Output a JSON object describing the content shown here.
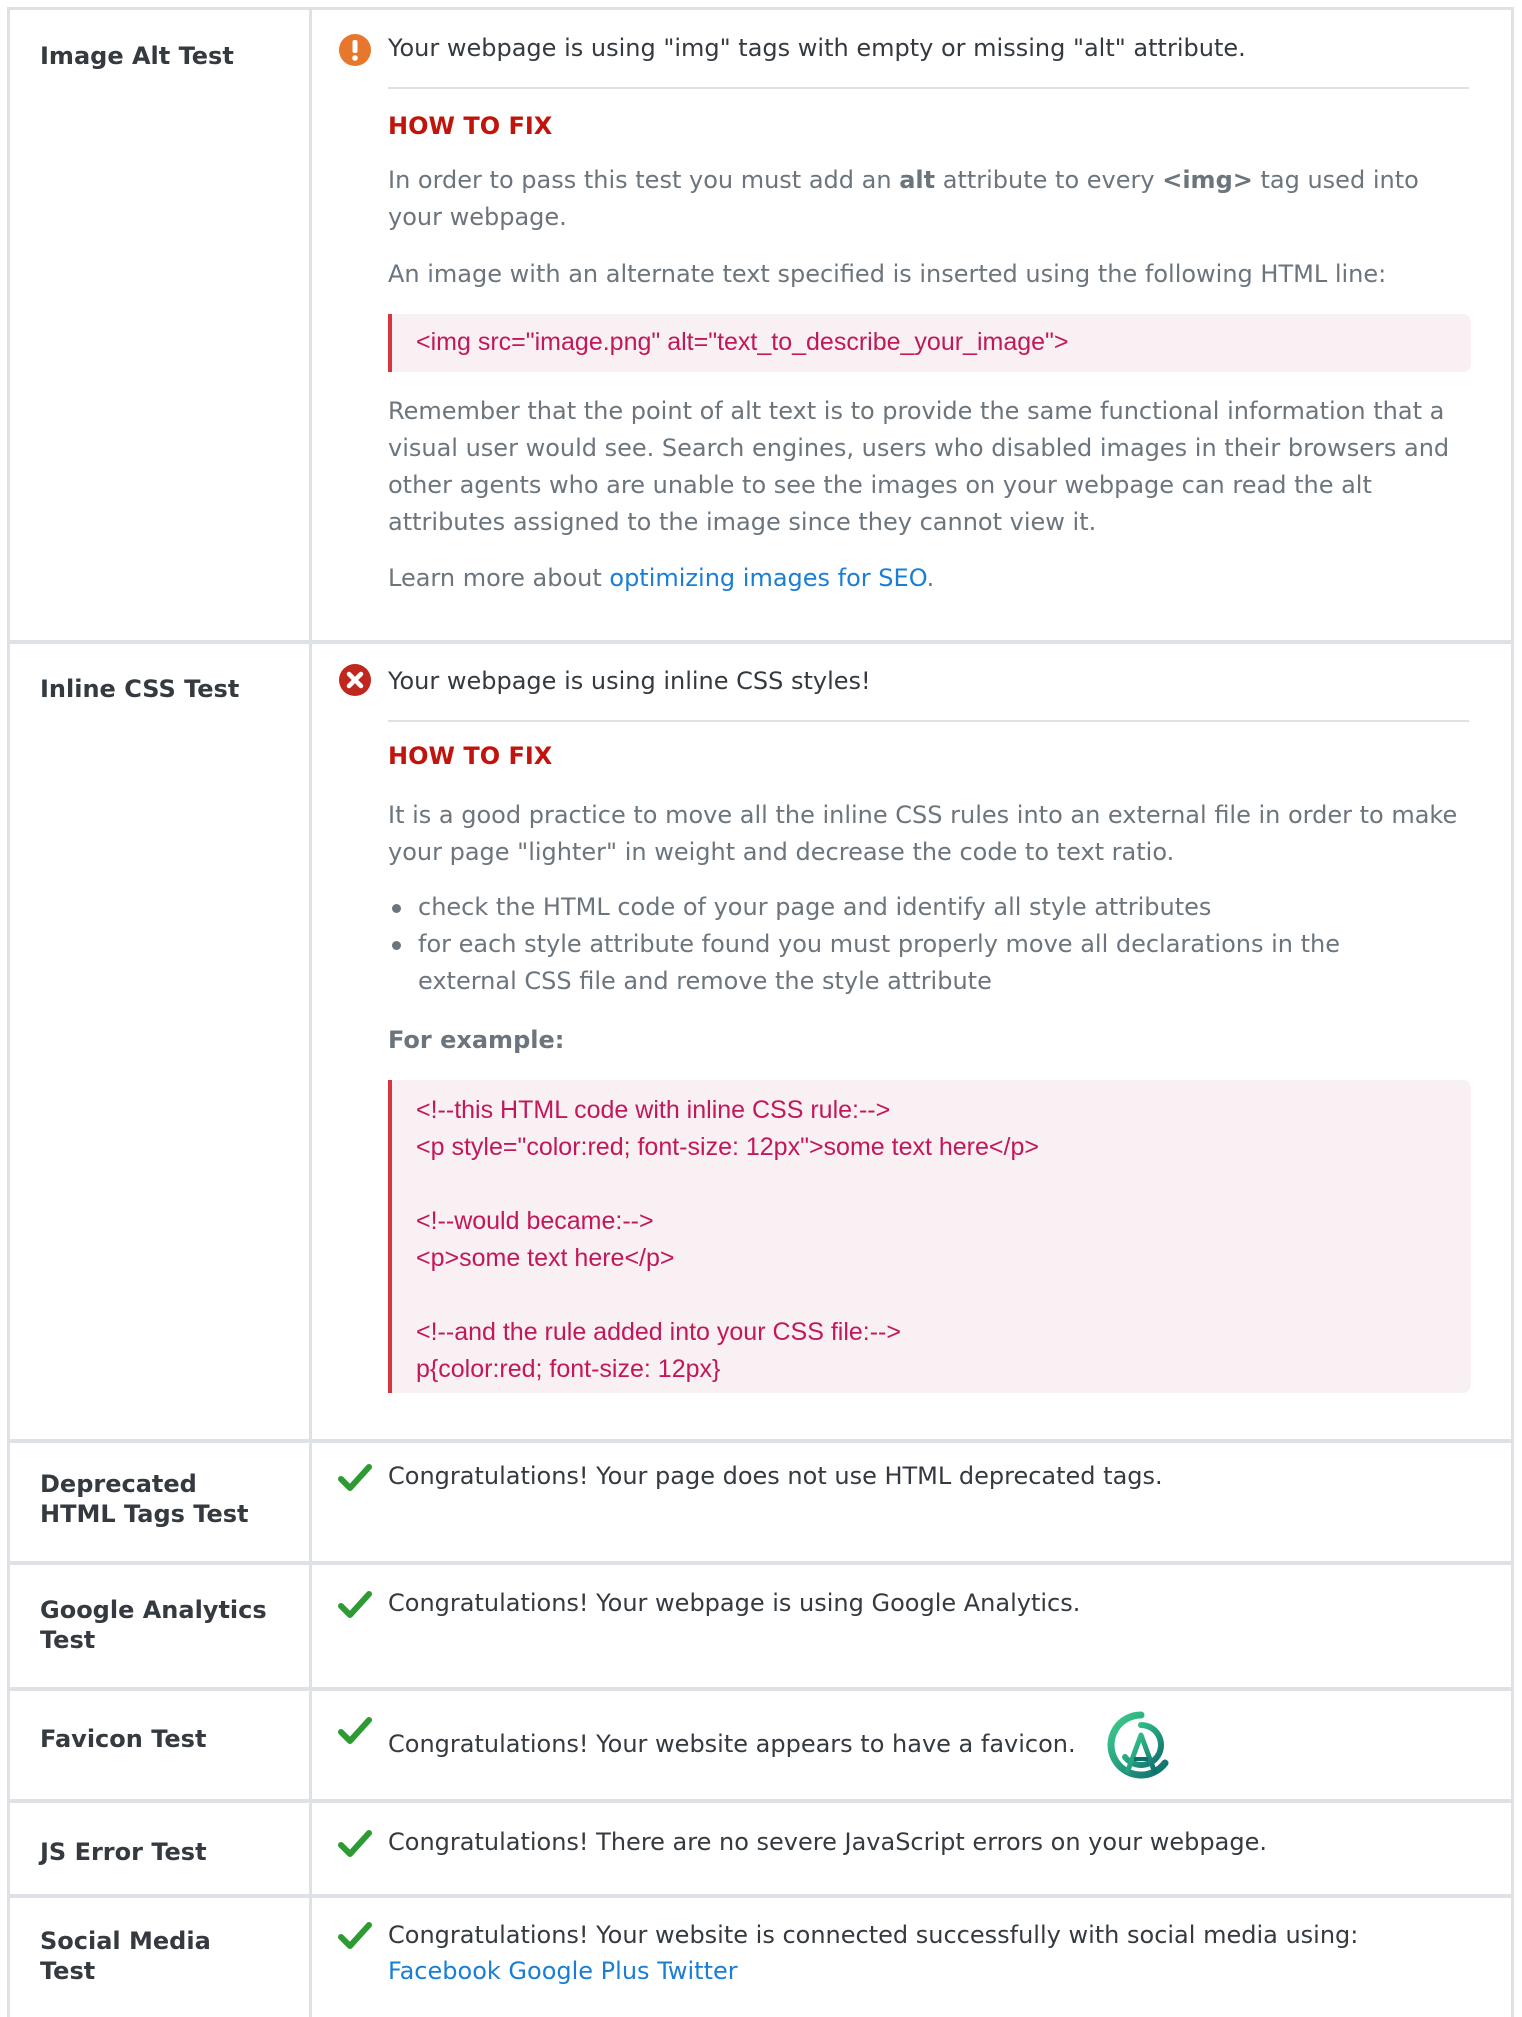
{
  "rows": {
    "image_alt": {
      "label": "Image Alt Test",
      "message": "Your webpage is using \"img\" tags with empty or missing \"alt\" attribute.",
      "how_to_fix": "HOW TO FIX",
      "p1_a": "In order to pass this test you must add an ",
      "p1_b": "alt",
      "p1_c": " attribute to every ",
      "p1_d": "<img>",
      "p1_e": " tag used into your webpage.",
      "p2": "An image with an alternate text specified is inserted using the following HTML line:",
      "code": "<img src=\"image.png\" alt=\"text_to_describe_your_image\">",
      "p3": "Remember that the point of alt text is to provide the same functional information that a visual user would see. Search engines, users who disabled images in their browsers and other agents who are unable to see the images on your webpage can read the alt attributes assigned to the image since they cannot view it.",
      "p4_a": "Learn more about ",
      "p4_link": "optimizing images for SEO",
      "p4_b": "."
    },
    "inline_css": {
      "label": "Inline CSS Test",
      "message": "Your webpage is using inline CSS styles!",
      "how_to_fix": "HOW TO FIX",
      "p1": "It is a good practice to move all the inline CSS rules into an external file in order to make your page \"lighter\" in weight and decrease the code to text ratio.",
      "bullet1": "check the HTML code of your page and identify all style attributes",
      "bullet2": "for each style attribute found you must properly move all declarations in the external CSS file and remove the style attribute",
      "example_label": "For example:",
      "code_lines": [
        "<!--this HTML code with inline CSS rule:-->",
        "<p style=\"color:red; font-size: 12px\">some text here</p>",
        "",
        "<!--would became:-->",
        "<p>some text here</p>",
        "",
        "<!--and the rule added into your CSS file:-->",
        "p{color:red; font-size: 12px}"
      ]
    },
    "deprecated": {
      "label_1": "Deprecated",
      "label_2": "HTML Tags Test",
      "message": "Congratulations! Your page does not use HTML deprecated tags."
    },
    "analytics": {
      "label_1": "Google Analytics",
      "label_2": "Test",
      "message": "Congratulations! Your webpage is using Google Analytics."
    },
    "favicon": {
      "label": "Favicon Test",
      "message": "Congratulations! Your website appears to have a favicon."
    },
    "js_error": {
      "label": "JS Error Test",
      "message": "Congratulations! There are no severe JavaScript errors on your webpage."
    },
    "social": {
      "label_1": "Social Media",
      "label_2": "Test",
      "message": "Congratulations! Your website is connected successfully with social media using:",
      "links": [
        "Facebook",
        "Google Plus",
        "Twitter"
      ]
    }
  },
  "colors": {
    "warning": "#e8772e",
    "error": "#c0281f",
    "success": "#2e9a33",
    "fix_title": "#c0140c",
    "code_text": "#c2185b",
    "link": "#1a7fd4"
  }
}
